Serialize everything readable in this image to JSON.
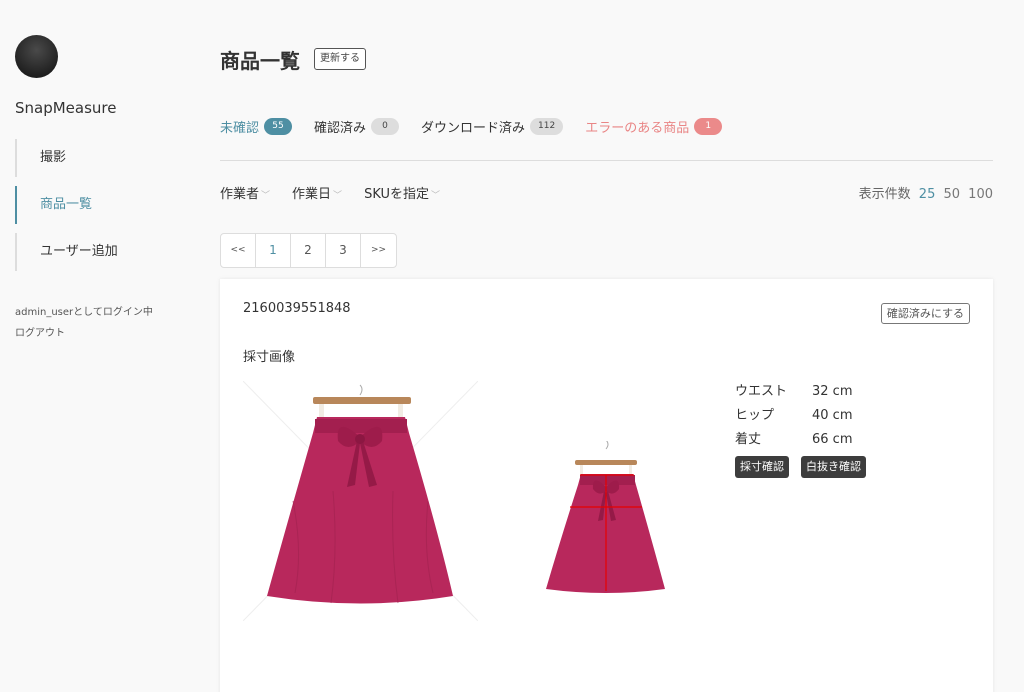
{
  "sidebar": {
    "brand": "SnapMeasure",
    "items": [
      {
        "label": "撮影",
        "active": false
      },
      {
        "label": "商品一覧",
        "active": true
      },
      {
        "label": "ユーザー追加",
        "active": false
      }
    ],
    "login_info": "admin_userとしてログイン中",
    "logout": "ログアウト"
  },
  "header": {
    "title": "商品一覧",
    "refresh_label": "更新する"
  },
  "tabs": [
    {
      "label": "未確認",
      "count": "55",
      "state": "active"
    },
    {
      "label": "確認済み",
      "count": "0",
      "state": "normal"
    },
    {
      "label": "ダウンロード済み",
      "count": "112",
      "state": "normal"
    },
    {
      "label": "エラーのある商品",
      "count": "1",
      "state": "error"
    }
  ],
  "filters": [
    {
      "label": "作業者"
    },
    {
      "label": "作業日"
    },
    {
      "label": "SKUを指定"
    }
  ],
  "perpage": {
    "label": "表示件数",
    "options": [
      "25",
      "50",
      "100"
    ],
    "selected": "25"
  },
  "pagination": {
    "prev": "<<",
    "pages": [
      "1",
      "2",
      "3"
    ],
    "current": "1",
    "next": ">>"
  },
  "item": {
    "sku": "2160039551848",
    "confirm_label": "確認済みにする",
    "section_label": "採寸画像",
    "measurements": [
      {
        "label": "ウエスト",
        "value": "32 cm"
      },
      {
        "label": "ヒップ",
        "value": "40 cm"
      },
      {
        "label": "着丈",
        "value": "66 cm"
      }
    ],
    "buttons": [
      "採寸確認",
      "白抜き確認"
    ],
    "skirt_color": "#b8285c"
  },
  "colors": {
    "accent": "#4e8fa3",
    "error": "#e98585"
  }
}
